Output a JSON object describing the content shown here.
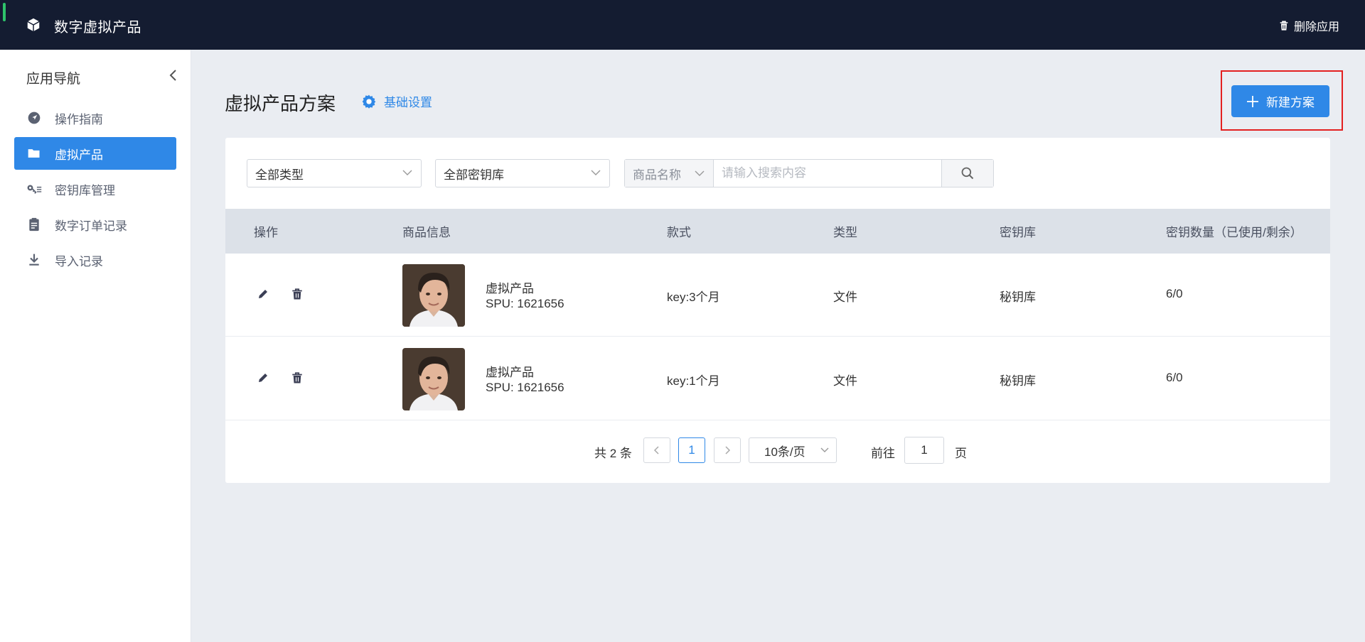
{
  "header": {
    "app_title": "数字虚拟产品",
    "delete_app_label": "删除应用"
  },
  "sidebar": {
    "title": "应用导航",
    "items": [
      {
        "label": "操作指南",
        "icon": "navigation-arrow-icon",
        "active": false
      },
      {
        "label": "虚拟产品",
        "icon": "folder-icon",
        "active": true
      },
      {
        "label": "密钥库管理",
        "icon": "key-icon",
        "active": false
      },
      {
        "label": "数字订单记录",
        "icon": "clipboard-icon",
        "active": false
      },
      {
        "label": "导入记录",
        "icon": "download-icon",
        "active": false
      }
    ]
  },
  "page": {
    "title": "虚拟产品方案",
    "settings_label": "基础设置",
    "new_plan_label": "新建方案"
  },
  "filters": {
    "type_select": "全部类型",
    "keylib_select": "全部密钥库",
    "search_field_select": "商品名称",
    "search_placeholder": "请输入搜索内容"
  },
  "table": {
    "columns": [
      "操作",
      "商品信息",
      "款式",
      "类型",
      "密钥库",
      "密钥数量（已使用/剩余）"
    ],
    "rows": [
      {
        "name": "虚拟产品",
        "spu": "SPU: 1621656",
        "style": "key:3个月",
        "type": "文件",
        "keylib": "秘钥库",
        "key_count": "6/0"
      },
      {
        "name": "虚拟产品",
        "spu": "SPU: 1621656",
        "style": "key:1个月",
        "type": "文件",
        "keylib": "秘钥库",
        "key_count": "6/0"
      }
    ]
  },
  "pagination": {
    "total_text": "共 2 条",
    "current_page": "1",
    "page_size": "10条/页",
    "goto_label": "前往",
    "goto_value": "1",
    "page_suffix": "页"
  },
  "colors": {
    "header_bg": "#141c31",
    "accent": "#2f88e7",
    "highlight_border": "#e32020"
  }
}
